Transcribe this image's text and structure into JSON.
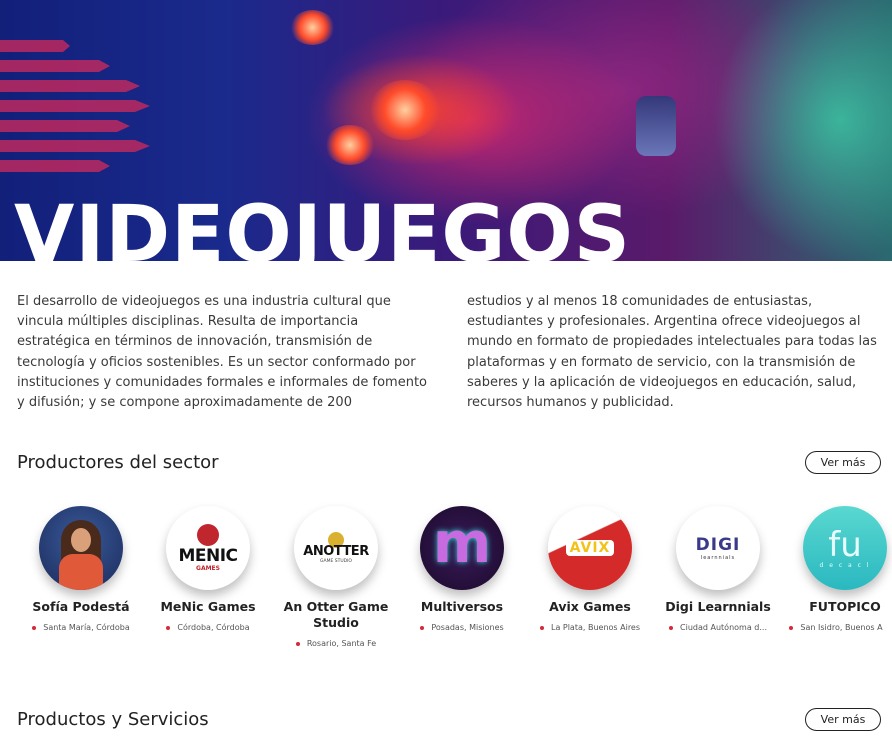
{
  "hero": {
    "title": "VIDEOJUEGOS"
  },
  "intro": {
    "col1": "El desarrollo de videojuegos es una industria cultural que vincula múltiples disciplinas. Resulta de importancia estratégica en términos de innovación, transmisión de tecnología y oficios sostenibles. Es un sector conformado por instituciones y comunidades formales e informales de fomento y difusión; y se compone aproximadamente de 200",
    "col2": "estudios y al menos 18 comunidades de entusiastas, estudiantes y profesionales. Argentina ofrece videojuegos al mundo en formato de propiedades intelectuales para todas las plataformas y en formato de servicio, con la transmisión de saberes y la aplicación de videojuegos en educación, salud, recursos humanos y publicidad."
  },
  "producers_section": {
    "title": "Productores del sector",
    "more_label": "Ver más",
    "items": [
      {
        "name": "Sofía Podestá",
        "location": "Santa María, Córdoba",
        "icon": "portrait-avatar-icon"
      },
      {
        "name": "MeNic Games",
        "location": "Córdoba, Córdoba",
        "icon": "menic-logo",
        "logo_text": "MENIC",
        "logo_sub": "GAMES"
      },
      {
        "name": "An Otter Game Studio",
        "location": "Rosario, Santa Fe",
        "icon": "otter-logo",
        "logo_text": "ANOTTER",
        "logo_sub": "GAME STUDIO"
      },
      {
        "name": "Multiversos",
        "location": "Posadas, Misiones",
        "icon": "multiversos-logo",
        "logo_text": "m"
      },
      {
        "name": "Avix Games",
        "location": "La Plata, Buenos Aires",
        "icon": "avix-logo",
        "logo_text": "AVIX"
      },
      {
        "name": "Digi Learnnials",
        "location": "Ciudad Autónoma d...",
        "icon": "digi-logo",
        "logo_text": "DIGI",
        "logo_sub": "learnnials"
      },
      {
        "name": "FUTOPICO",
        "location": "San Isidro, Buenos A",
        "icon": "futopico-logo",
        "logo_text": "fu",
        "logo_sub": "d e c a c l"
      }
    ]
  },
  "products_section": {
    "title": "Productos y Servicios",
    "more_label": "Ver más"
  },
  "colors": {
    "accent_red": "#d42a3a",
    "hero_blue": "#1a2a8c",
    "hero_magenta": "#c0287a"
  }
}
